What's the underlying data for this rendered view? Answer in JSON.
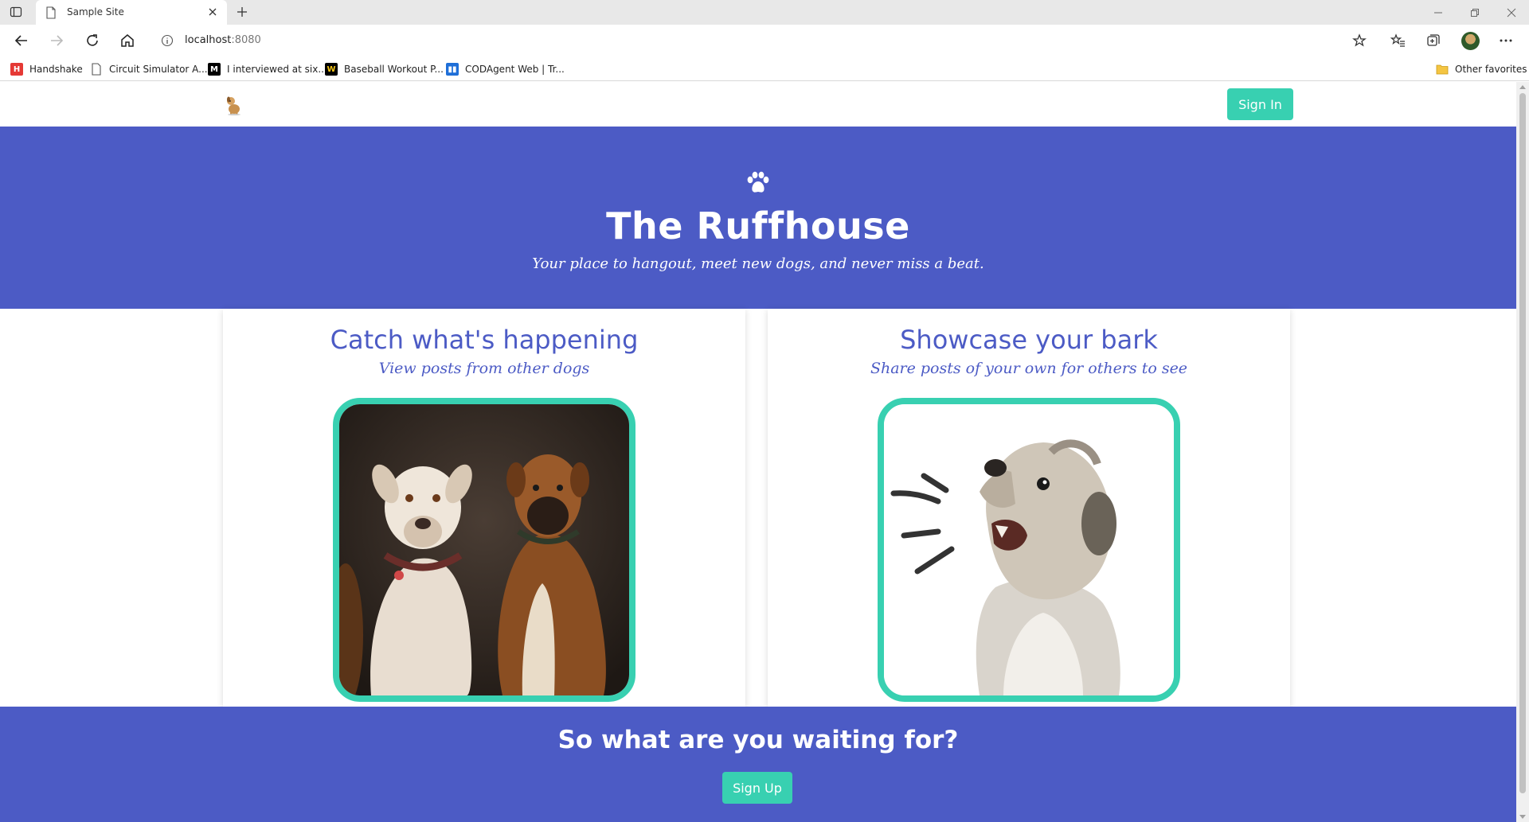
{
  "browser": {
    "tab_title": "Sample Site",
    "url_host": "localhost",
    "url_port": ":8080",
    "bookmarks": [
      {
        "label": "Handshake",
        "icon": "handshake-icon",
        "color": "#e53935"
      },
      {
        "label": "Circuit Simulator A...",
        "icon": "page-icon",
        "color": "#ffffff"
      },
      {
        "label": "I interviewed at six...",
        "icon": "medium-icon",
        "color": "#000000"
      },
      {
        "label": "Baseball Workout P...",
        "icon": "w-icon",
        "color": "#000000"
      },
      {
        "label": "CODAgent Web | Tr...",
        "icon": "trello-icon",
        "color": "#1f6fd8"
      }
    ],
    "other_favorites": "Other favorites"
  },
  "site": {
    "signin_label": "Sign In",
    "hero": {
      "title": "The Ruffhouse",
      "subtitle": "Your place to hangout, meet new dogs, and never miss a beat."
    },
    "cards": [
      {
        "title": "Catch what's happening",
        "subtitle": "View posts from other dogs",
        "image": "two-dogs-photo"
      },
      {
        "title": "Showcase your bark",
        "subtitle": "Share posts of your own for others to see",
        "image": "barking-dog-photo"
      }
    ],
    "cta": {
      "title": "So what are you waiting for?",
      "signup_label": "Sign Up"
    }
  },
  "colors": {
    "brand_blue": "#4c5bc5",
    "accent_teal": "#38d0b1"
  }
}
